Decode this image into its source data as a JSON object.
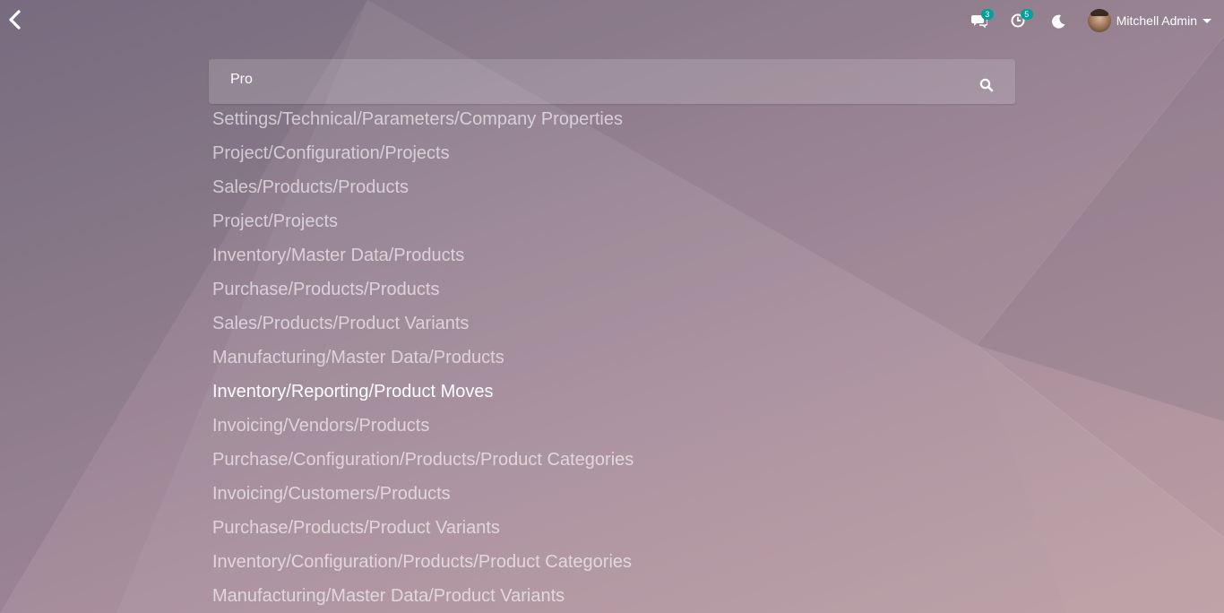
{
  "topbar": {
    "back_icon": "chevron-left-icon",
    "messages": {
      "icon": "comments-icon",
      "count": "3"
    },
    "activities": {
      "icon": "clock-icon",
      "count": "5"
    },
    "theme_toggle": {
      "icon": "moon-icon"
    },
    "user": {
      "name": "Mitchell Admin",
      "icon": "caret-down-icon"
    }
  },
  "search": {
    "value": "Pro",
    "icon": "search-icon"
  },
  "results": [
    "Settings/Technical/Parameters/Company Properties",
    "Project/Configuration/Projects",
    "Sales/Products/Products",
    "Project/Projects",
    "Inventory/Master Data/Products",
    "Purchase/Products/Products",
    "Sales/Products/Product Variants",
    "Manufacturing/Master Data/Products",
    "Inventory/Reporting/Product Moves",
    "Invoicing/Vendors/Products",
    "Purchase/Configuration/Products/Product Categories",
    "Invoicing/Customers/Products",
    "Purchase/Products/Product Variants",
    "Inventory/Configuration/Products/Product Categories",
    "Manufacturing/Master Data/Product Variants"
  ],
  "focused_result_index": 8,
  "colors": {
    "badge": "#00a09d",
    "text": "#ffffff"
  }
}
